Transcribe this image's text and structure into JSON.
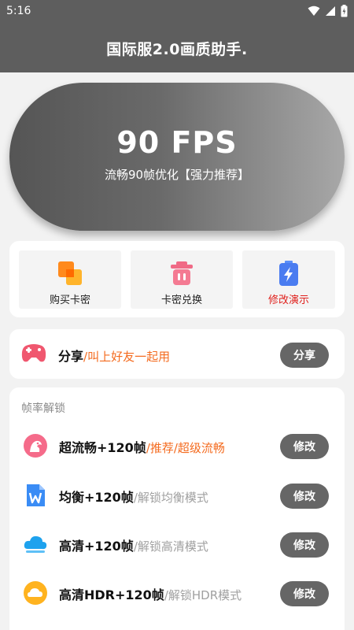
{
  "status_bar": {
    "time": "5:16"
  },
  "header": {
    "title": "国际服2.0画质助手."
  },
  "hero": {
    "fps": "90 FPS",
    "subtitle": "流畅90帧优化【强力推荐】"
  },
  "quick_actions": [
    {
      "label": "购买卡密",
      "icon": "orange-squares-icon",
      "color": "#222222"
    },
    {
      "label": "卡密兑换",
      "icon": "pink-trash-icon",
      "color": "#222222"
    },
    {
      "label": "修改演示",
      "icon": "blue-battery-icon",
      "color": "#e0201c"
    }
  ],
  "share": {
    "title": "分享",
    "subtitle": "/叫上好友一起用",
    "button": "分享",
    "icon": "pink-gamepad-icon"
  },
  "unlock": {
    "section_title": "帧率解锁",
    "items": [
      {
        "title": "超流畅+120帧",
        "subtitle": "/推荐/超级流畅",
        "subtitle_color": "orange",
        "button": "修改",
        "icon": "pink-bird-icon"
      },
      {
        "title": "均衡+120帧",
        "subtitle": "/解锁均衡模式",
        "subtitle_color": "gray",
        "button": "修改",
        "icon": "blue-w-doc-icon"
      },
      {
        "title": "高清+120帧",
        "subtitle": "/解锁高清模式",
        "subtitle_color": "gray",
        "button": "修改",
        "icon": "blue-cloud-icon"
      },
      {
        "title": "高清HDR+120帧",
        "subtitle": "/解锁HDR模式",
        "subtitle_color": "gray",
        "button": "修改",
        "icon": "orange-cloud-icon"
      }
    ]
  },
  "colors": {
    "header_bg": "#5e5e5e",
    "button_bg": "#666666",
    "accent_orange": "#f46b1f",
    "accent_red": "#e0201c"
  }
}
